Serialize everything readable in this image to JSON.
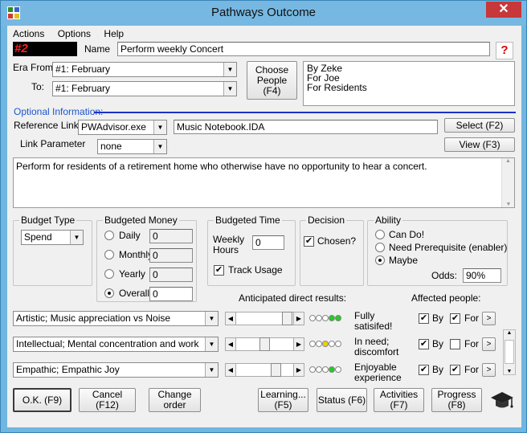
{
  "window": {
    "title": "Pathways Outcome",
    "close": "✕"
  },
  "menu": [
    "Actions",
    "Options",
    "Help"
  ],
  "header": {
    "number": "#2",
    "name_label": "Name",
    "name_value": "Perform weekly Concert"
  },
  "era": {
    "from_label": "Era From:",
    "from_value": "#1: February",
    "to_label": "To:",
    "to_value": "#1: February"
  },
  "choose_people_button": "Choose People (F4)",
  "people": [
    "By Zeke",
    "For Joe",
    "For Residents"
  ],
  "optional_label": "Optional Information:",
  "reference": {
    "label": "Reference Link",
    "app_value": "PWAdvisor.exe",
    "file_value": "Music Notebook.IDA",
    "select_button": "Select (F2)"
  },
  "link_param": {
    "label": "Link Parameter",
    "value": "none",
    "view_button": "View (F3)"
  },
  "description": "Perform for residents of a retirement home who otherwise have no opportunity to hear a concert.",
  "budget_type": {
    "title": "Budget Type",
    "value": "Spend"
  },
  "budgeted_money": {
    "title": "Budgeted Money",
    "rows": [
      {
        "label": "Daily",
        "value": "0",
        "selected": false
      },
      {
        "label": "Monthly",
        "value": "0",
        "selected": false
      },
      {
        "label": "Yearly",
        "value": "0",
        "selected": false
      },
      {
        "label": "Overall",
        "value": "0",
        "selected": true
      }
    ]
  },
  "budgeted_time": {
    "title": "Budgeted Time",
    "weekly_label": "Weekly Hours",
    "weekly_value": "0",
    "track_label": "Track Usage",
    "track_checked": true
  },
  "decision": {
    "title": "Decision",
    "chosen_label": "Chosen?",
    "chosen_checked": true
  },
  "ability": {
    "title": "Ability",
    "options": [
      {
        "label": "Can Do!",
        "selected": false
      },
      {
        "label": "Need Prerequisite (enabler)",
        "selected": false
      },
      {
        "label": "Maybe",
        "selected": true
      }
    ],
    "odds_label": "Odds:",
    "odds_value": "90%"
  },
  "results_header": "Anticipated direct results:",
  "affected_header": "Affected people:",
  "results": [
    {
      "category": "Artistic; Music appreciation vs Noise",
      "status": "Fully satisifed!",
      "by_checked": true,
      "for_checked": true,
      "level": 5,
      "color": "#22cc22",
      "by_label": "By",
      "for_label": "For"
    },
    {
      "category": "Intellectual; Mental concentration and work",
      "status": "In need; discomfort",
      "by_checked": true,
      "for_checked": false,
      "level": 3,
      "color": "#e8d400",
      "by_label": "By",
      "for_label": "For"
    },
    {
      "category": "Empathic; Empathic Joy",
      "status": "Enjoyable experience",
      "by_checked": true,
      "for_checked": true,
      "level": 4,
      "color": "#22cc22",
      "by_label": "By",
      "for_label": "For"
    }
  ],
  "buttons": {
    "ok": "O.K. (F9)",
    "cancel": "Cancel (F12)",
    "change_order": "Change order",
    "learning": "Learning... (F5)",
    "status": "Status (F6)",
    "activities": "Activities (F7)",
    "progress": "Progress (F8)"
  },
  "help_mark": "?"
}
